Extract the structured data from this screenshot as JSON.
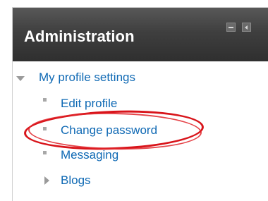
{
  "block": {
    "title": "Administration",
    "controls": {
      "hide_icon": "minus-box-icon",
      "dock_icon": "dock-left-icon"
    }
  },
  "tree": {
    "parent": {
      "label": "My profile settings",
      "expanded": true
    },
    "children": [
      {
        "label": "Edit profile",
        "icon": "bullet-square"
      },
      {
        "label": "Change password",
        "icon": "bullet-square",
        "highlighted": true
      },
      {
        "label": "Messaging",
        "icon": "bullet-square"
      },
      {
        "label": "Blogs",
        "icon": "collapsed-arrow"
      }
    ]
  },
  "colors": {
    "header_dark": "#2f2f2f",
    "link": "#0f69b4",
    "highlight": "#d8141a"
  }
}
